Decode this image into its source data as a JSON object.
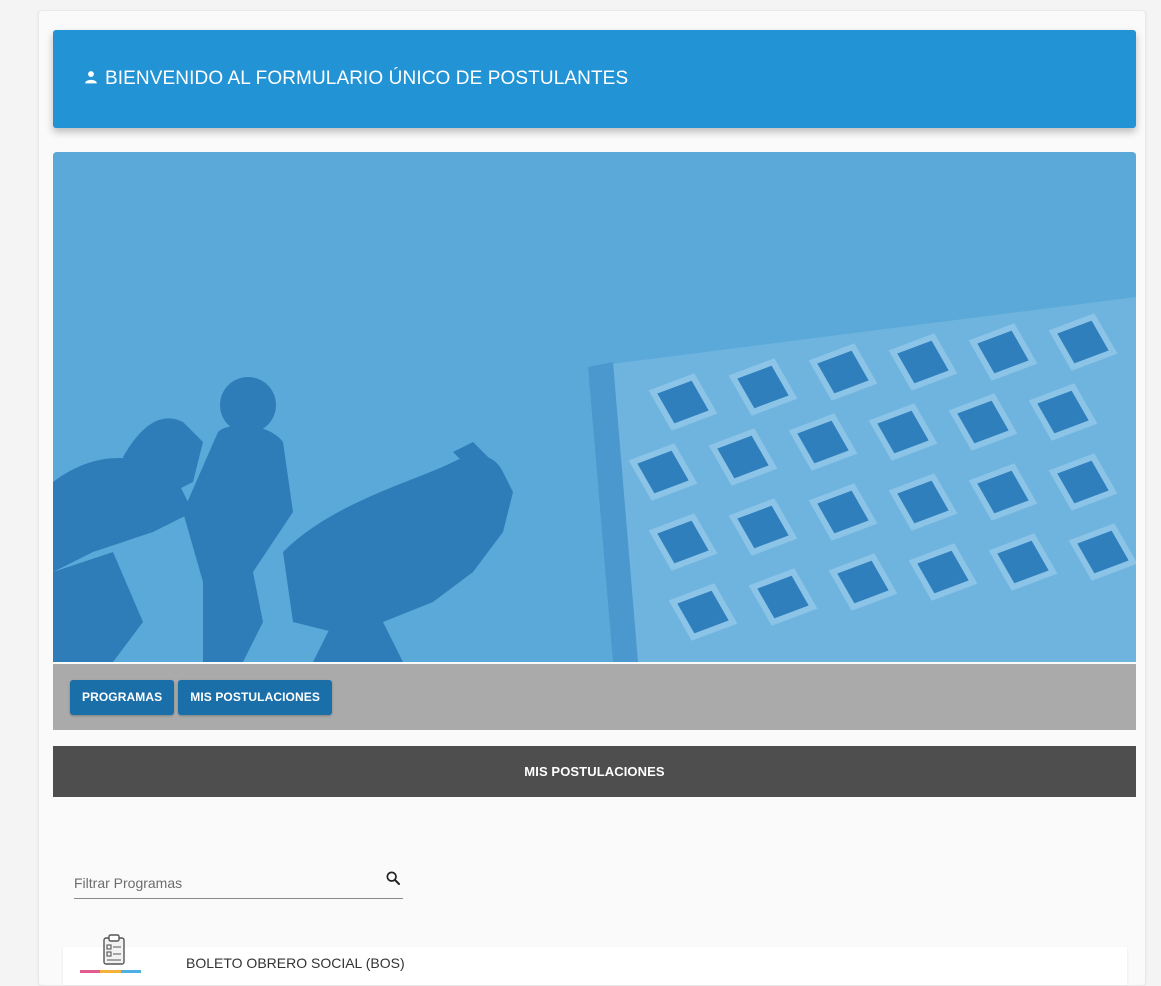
{
  "header": {
    "title": "BIENVENIDO AL FORMULARIO ÚNICO DE POSTULANTES",
    "icon": "user-icon",
    "color": "#2293d4"
  },
  "hero": {
    "overlay_color": "#5aa9d9"
  },
  "nav": {
    "buttons": [
      {
        "label": "PROGRAMAS"
      },
      {
        "label": "MIS POSTULACIONES"
      }
    ],
    "button_color": "#1b6fa8"
  },
  "section": {
    "title": "MIS POSTULACIONES"
  },
  "filter": {
    "placeholder": "Filtrar Programas",
    "value": "",
    "icon": "search-icon"
  },
  "programs": [
    {
      "name": "BOLETO OBRERO SOCIAL (BOS)",
      "icon": "clipboard-icon",
      "strip_colors": [
        "#e45b8d",
        "#f6b13b",
        "#4fb0e6"
      ]
    }
  ]
}
